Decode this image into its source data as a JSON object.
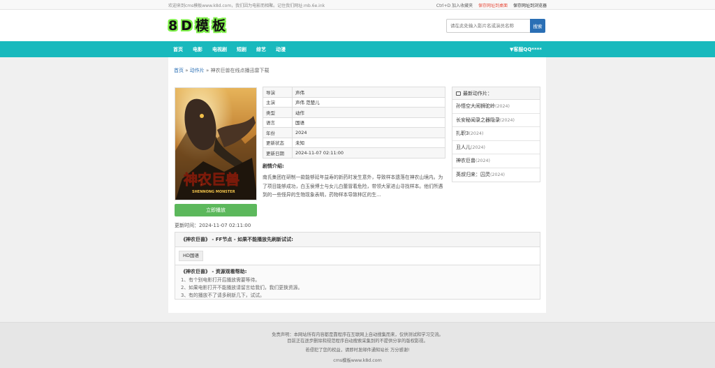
{
  "topbar": {
    "welcome": "欢迎来到cms模板www.k8d.com，我们因为电影而相聚。记住我们网址:mb.6e.ink",
    "shortcut": "Ctrl+D 加入收藏夹",
    "save_desktop": "保存网址到桌面",
    "save_browser": "保存网址到浏览器"
  },
  "header": {
    "logo": "8D模板",
    "search_placeholder": "请在此处输入影片名或演员名称",
    "search_button": "搜索"
  },
  "nav": {
    "items": [
      "首页",
      "电影",
      "电视剧",
      "短剧",
      "综艺",
      "动漫"
    ],
    "qq": "▼客服QQ****"
  },
  "breadcrumb": {
    "home": "首页",
    "sep1": " » ",
    "category": "动作片",
    "sep2": " » ",
    "current": "神农巨兽在线点播迅雷下载"
  },
  "poster": {
    "title_cn": "神农巨兽",
    "title_en": "SHENNONG MONSTER"
  },
  "info": [
    {
      "k": "导演",
      "v": "声伟"
    },
    {
      "k": "主演",
      "v": "声伟 范楚儿"
    },
    {
      "k": "类型",
      "v": "动作"
    },
    {
      "k": "语言",
      "v": "国语"
    },
    {
      "k": "年份",
      "v": "2024"
    },
    {
      "k": "更新状态",
      "v": "未知"
    },
    {
      "k": "更新日期",
      "v": "2024-11-07 02:11:00"
    }
  ],
  "intro": {
    "title": "剧情介绍:",
    "text": "南氏集团在研制一款能够延年益寿的新药时发生意外，导致样本遗落在神农山境内。为了项目能够成功，白玉侯博士与女儿白蕾冒着危险，带领大家进山寻找样本。他们所遇到的一些怪异的生物现象表明，药物样本导致林区的生..."
  },
  "play_button": "立即播放",
  "update_time": "更新时间：2024-11-07 02:11:00",
  "latest": {
    "title": "最新动作片：",
    "items": [
      {
        "t": "孙悟空大闹狮驼岭",
        "y": "(2024)"
      },
      {
        "t": "长安秘闻录之器隐录",
        "y": "(2024)"
      },
      {
        "t": "扎职3",
        "y": "(2024)"
      },
      {
        "t": "丑人儿",
        "y": "(2024)"
      },
      {
        "t": "神农巨兽",
        "y": "(2024)"
      },
      {
        "t": "英叔归来：囚灵",
        "y": "(2024)"
      }
    ]
  },
  "source": {
    "title": "《神农巨兽》 - FF节点 - 如果不能播放先刷新试试:",
    "tag": "HD国语",
    "help_title": "《神农巨兽》 - 资源观看帮助:",
    "help": [
      "1、有个别电影打开后播放需要等待。",
      "2、如果电影打开不能播放请留言给我们，我们更换资源。",
      "3、有的播放不了请多刷新几下，试试。"
    ]
  },
  "footer": {
    "line1": "免责声明：本网站所有内容都是靠程序在互联网上自动搜集而来，仅供测试和学习交流。",
    "line2": "目前正在逐步删除和规范程序自动搜索采集到的不提供分享的版权影视。",
    "line3": "若侵犯了您的权益，请即时发邮件通知站长 万分感谢!",
    "line4": "cms模板www.k8d.com"
  },
  "colors": {
    "nav_bg": "#19b9bd",
    "search_btn": "#2a6fb5",
    "play_btn": "#5cb85c",
    "logo_glow": "#7ff04a"
  }
}
